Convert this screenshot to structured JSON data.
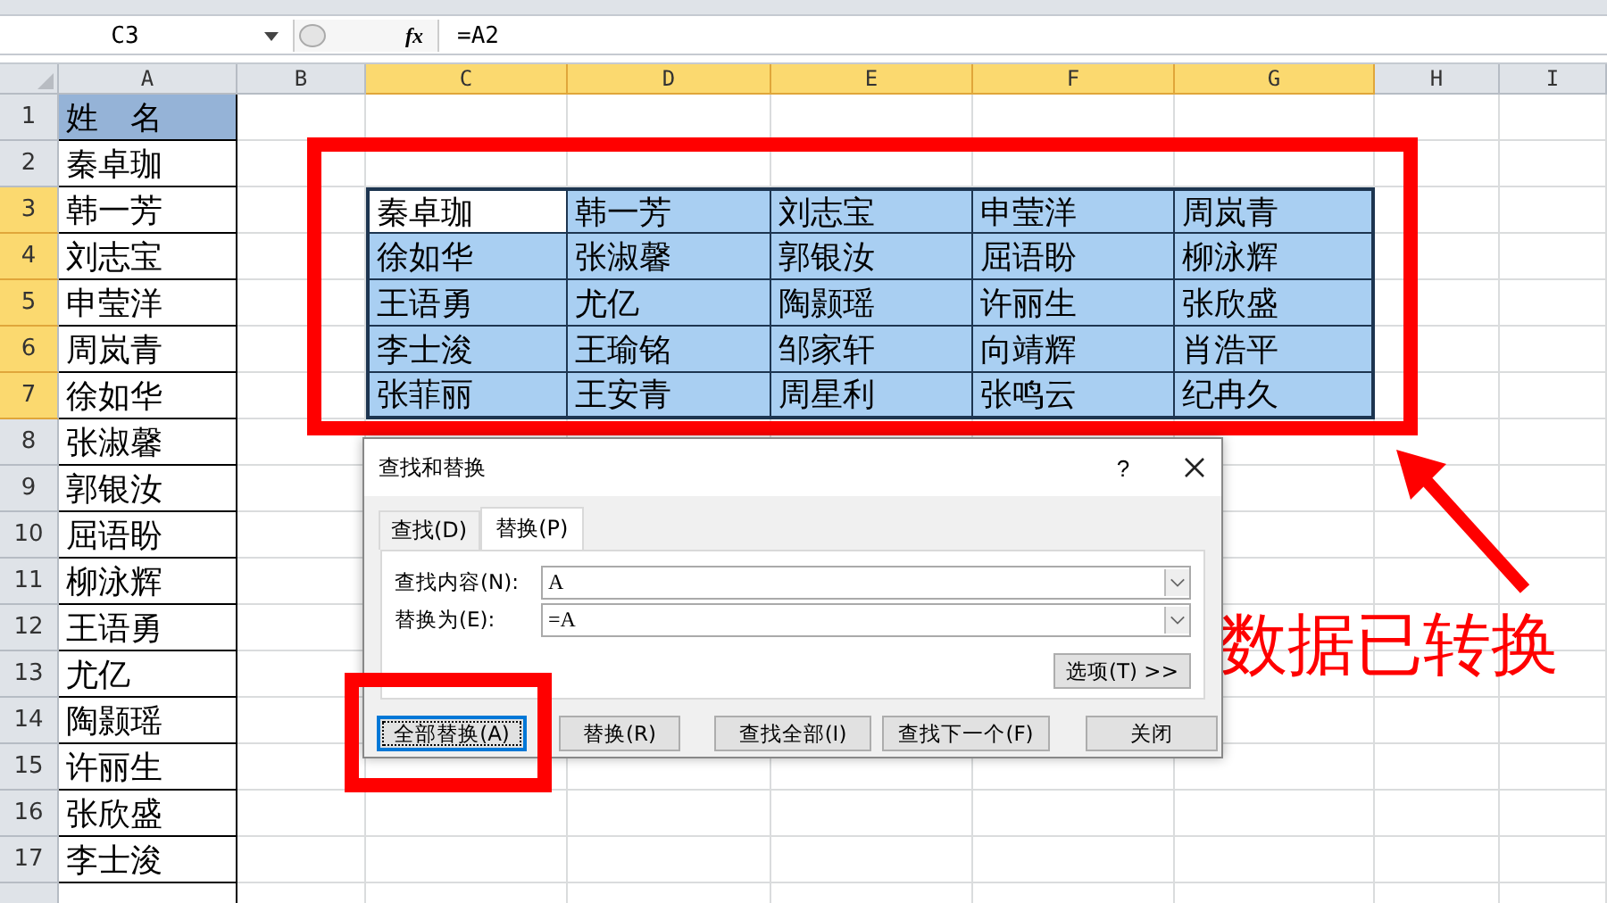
{
  "name_box": "C3",
  "fx": "fx",
  "formula": "=A2",
  "columns": [
    {
      "label": "A",
      "selected": false
    },
    {
      "label": "B",
      "selected": false
    },
    {
      "label": "C",
      "selected": true
    },
    {
      "label": "D",
      "selected": true
    },
    {
      "label": "E",
      "selected": true
    },
    {
      "label": "F",
      "selected": true
    },
    {
      "label": "G",
      "selected": true
    },
    {
      "label": "H",
      "selected": false
    },
    {
      "label": "I",
      "selected": false
    }
  ],
  "rows": [
    {
      "number": "1",
      "selected": false,
      "name": "姓　名",
      "header": true
    },
    {
      "number": "2",
      "selected": false,
      "name": "秦卓珈",
      "header": false
    },
    {
      "number": "3",
      "selected": true,
      "name": "韩一芳",
      "header": false
    },
    {
      "number": "4",
      "selected": true,
      "name": "刘志宝",
      "header": false
    },
    {
      "number": "5",
      "selected": true,
      "name": "申莹洋",
      "header": false
    },
    {
      "number": "6",
      "selected": true,
      "name": "周岚青",
      "header": false
    },
    {
      "number": "7",
      "selected": true,
      "name": "徐如华",
      "header": false
    },
    {
      "number": "8",
      "selected": false,
      "name": "张淑馨",
      "header": false
    },
    {
      "number": "9",
      "selected": false,
      "name": "郭银汝",
      "header": false
    },
    {
      "number": "10",
      "selected": false,
      "name": "屈语盼",
      "header": false
    },
    {
      "number": "11",
      "selected": false,
      "name": "柳泳辉",
      "header": false
    },
    {
      "number": "12",
      "selected": false,
      "name": "王语勇",
      "header": false
    },
    {
      "number": "13",
      "selected": false,
      "name": "尤亿",
      "header": false
    },
    {
      "number": "14",
      "selected": false,
      "name": "陶颢瑶",
      "header": false
    },
    {
      "number": "15",
      "selected": false,
      "name": "许丽生",
      "header": false
    },
    {
      "number": "16",
      "selected": false,
      "name": "张欣盛",
      "header": false
    },
    {
      "number": "17",
      "selected": false,
      "name": "李士浚",
      "header": false
    }
  ],
  "range_rows": [
    [
      {
        "text": "秦卓珈",
        "active": true
      },
      {
        "text": "韩一芳",
        "active": false
      },
      {
        "text": "刘志宝",
        "active": false
      },
      {
        "text": "申莹洋",
        "active": false
      },
      {
        "text": "周岚青",
        "active": false
      }
    ],
    [
      {
        "text": "徐如华",
        "active": false
      },
      {
        "text": "张淑馨",
        "active": false
      },
      {
        "text": "郭银汝",
        "active": false
      },
      {
        "text": "屈语盼",
        "active": false
      },
      {
        "text": "柳泳辉",
        "active": false
      }
    ],
    [
      {
        "text": "王语勇",
        "active": false
      },
      {
        "text": "尤亿",
        "active": false
      },
      {
        "text": "陶颢瑶",
        "active": false
      },
      {
        "text": "许丽生",
        "active": false
      },
      {
        "text": "张欣盛",
        "active": false
      }
    ],
    [
      {
        "text": "李士浚",
        "active": false
      },
      {
        "text": "王瑜铭",
        "active": false
      },
      {
        "text": "邹家轩",
        "active": false
      },
      {
        "text": "向靖辉",
        "active": false
      },
      {
        "text": "肖浩平",
        "active": false
      }
    ],
    [
      {
        "text": "张菲丽",
        "active": false
      },
      {
        "text": "王安青",
        "active": false
      },
      {
        "text": "周星利",
        "active": false
      },
      {
        "text": "张鸣云",
        "active": false
      },
      {
        "text": "纪冉久",
        "active": false
      }
    ]
  ],
  "dialog": {
    "title": "查找和替换",
    "help": "?",
    "tabs": [
      {
        "label": "查找(D)",
        "selected": false
      },
      {
        "label": "替换(P)",
        "selected": true
      }
    ],
    "fields": [
      {
        "label": "查找内容(N):",
        "value": "A"
      },
      {
        "label": "替换为(E):",
        "value": "=A"
      }
    ],
    "options_button": "选项(T) >>",
    "buttons": [
      {
        "label": "全部替换(A)",
        "focused": true
      },
      {
        "label": "替换(R)",
        "focused": false
      },
      {
        "label": "查找全部(I)",
        "focused": false
      },
      {
        "label": "查找下一个(F)",
        "focused": false
      },
      {
        "label": "关闭",
        "focused": false
      }
    ]
  },
  "note": "数据已转换"
}
